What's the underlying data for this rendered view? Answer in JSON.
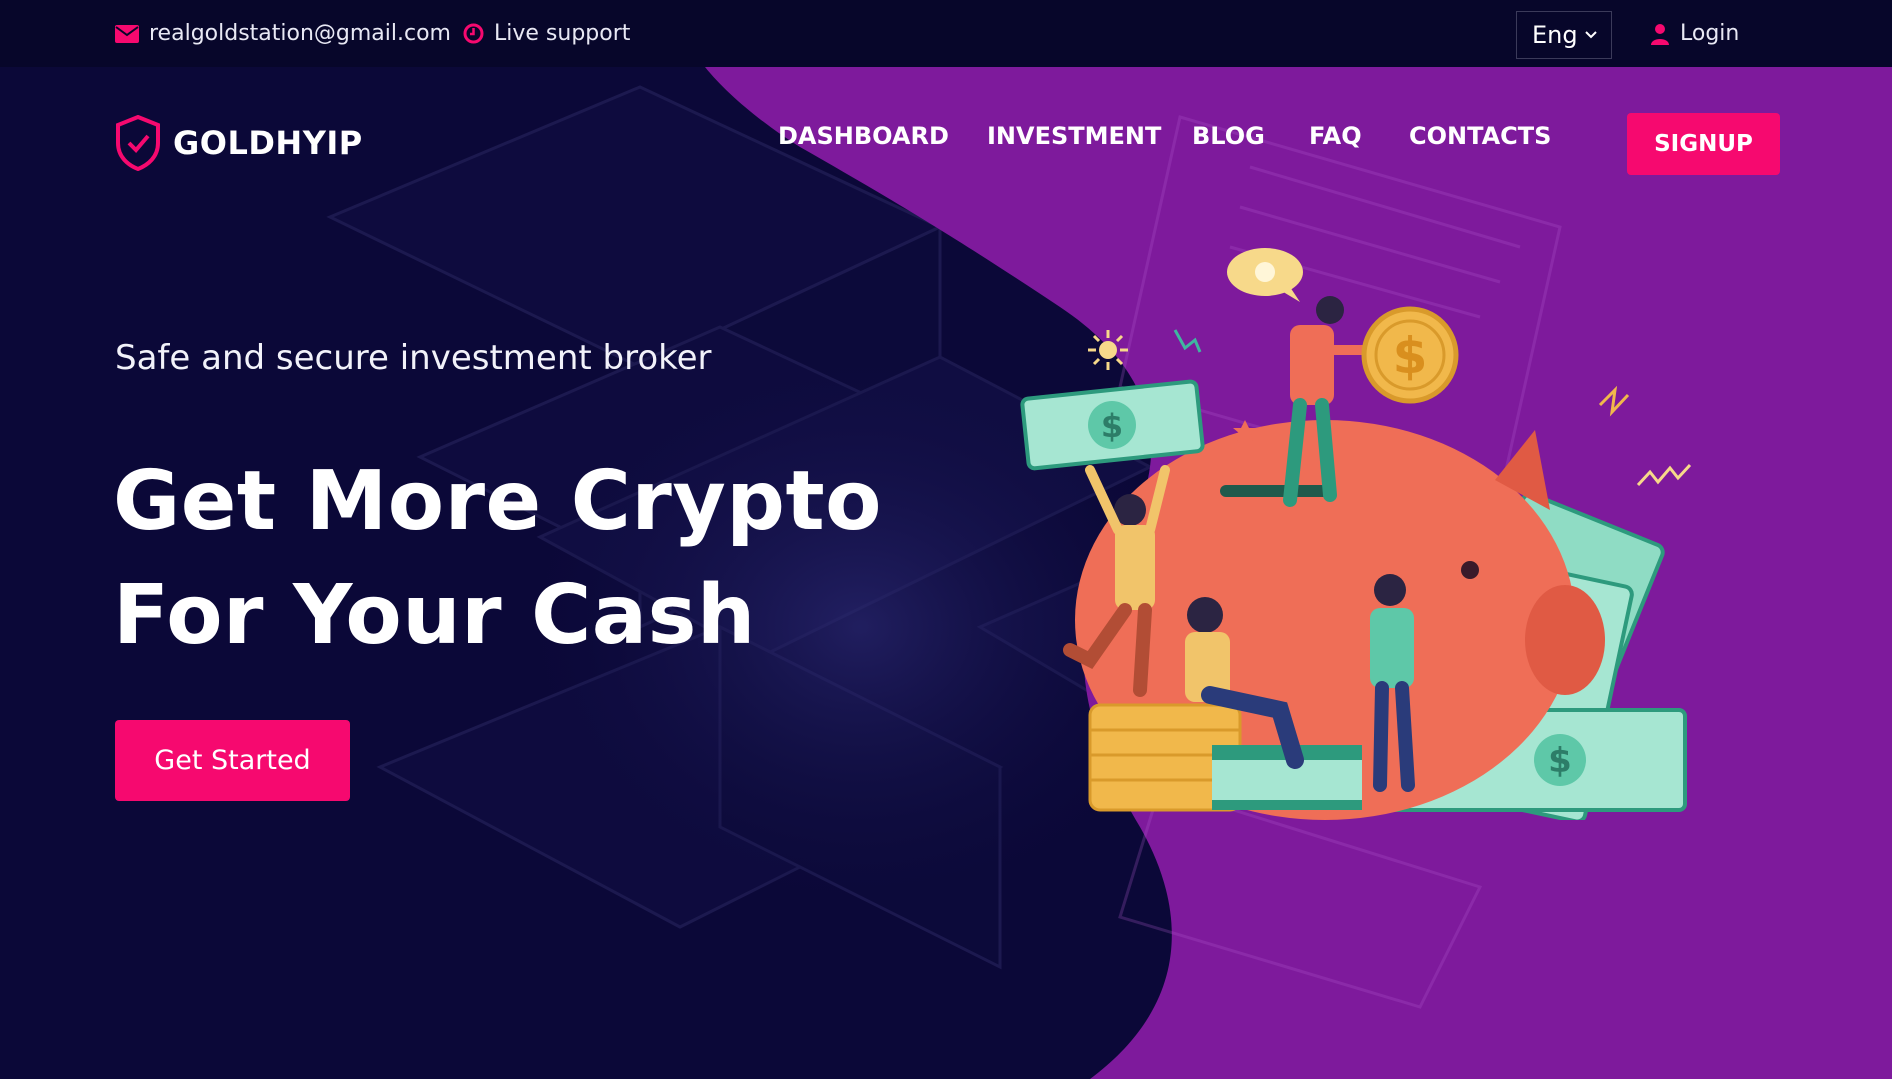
{
  "topbar": {
    "email": "realgoldstation@gmail.com",
    "support": "Live support",
    "language": "Eng",
    "login": "Login"
  },
  "brand": {
    "name": "GOLDHYIP",
    "accent": "#f6096f",
    "bg_dark": "#0b0838",
    "bg_purple": "#7e1a9c"
  },
  "nav": {
    "items": [
      "DASHBOARD",
      "INVESTMENT",
      "BLOG",
      "FAQ",
      "CONTACTS"
    ],
    "signup": "SIGNUP"
  },
  "hero": {
    "tagline": "Safe and secure investment broker",
    "headline_line1": "Get More Crypto",
    "headline_line2": "For Your Cash",
    "cta": "Get Started"
  }
}
